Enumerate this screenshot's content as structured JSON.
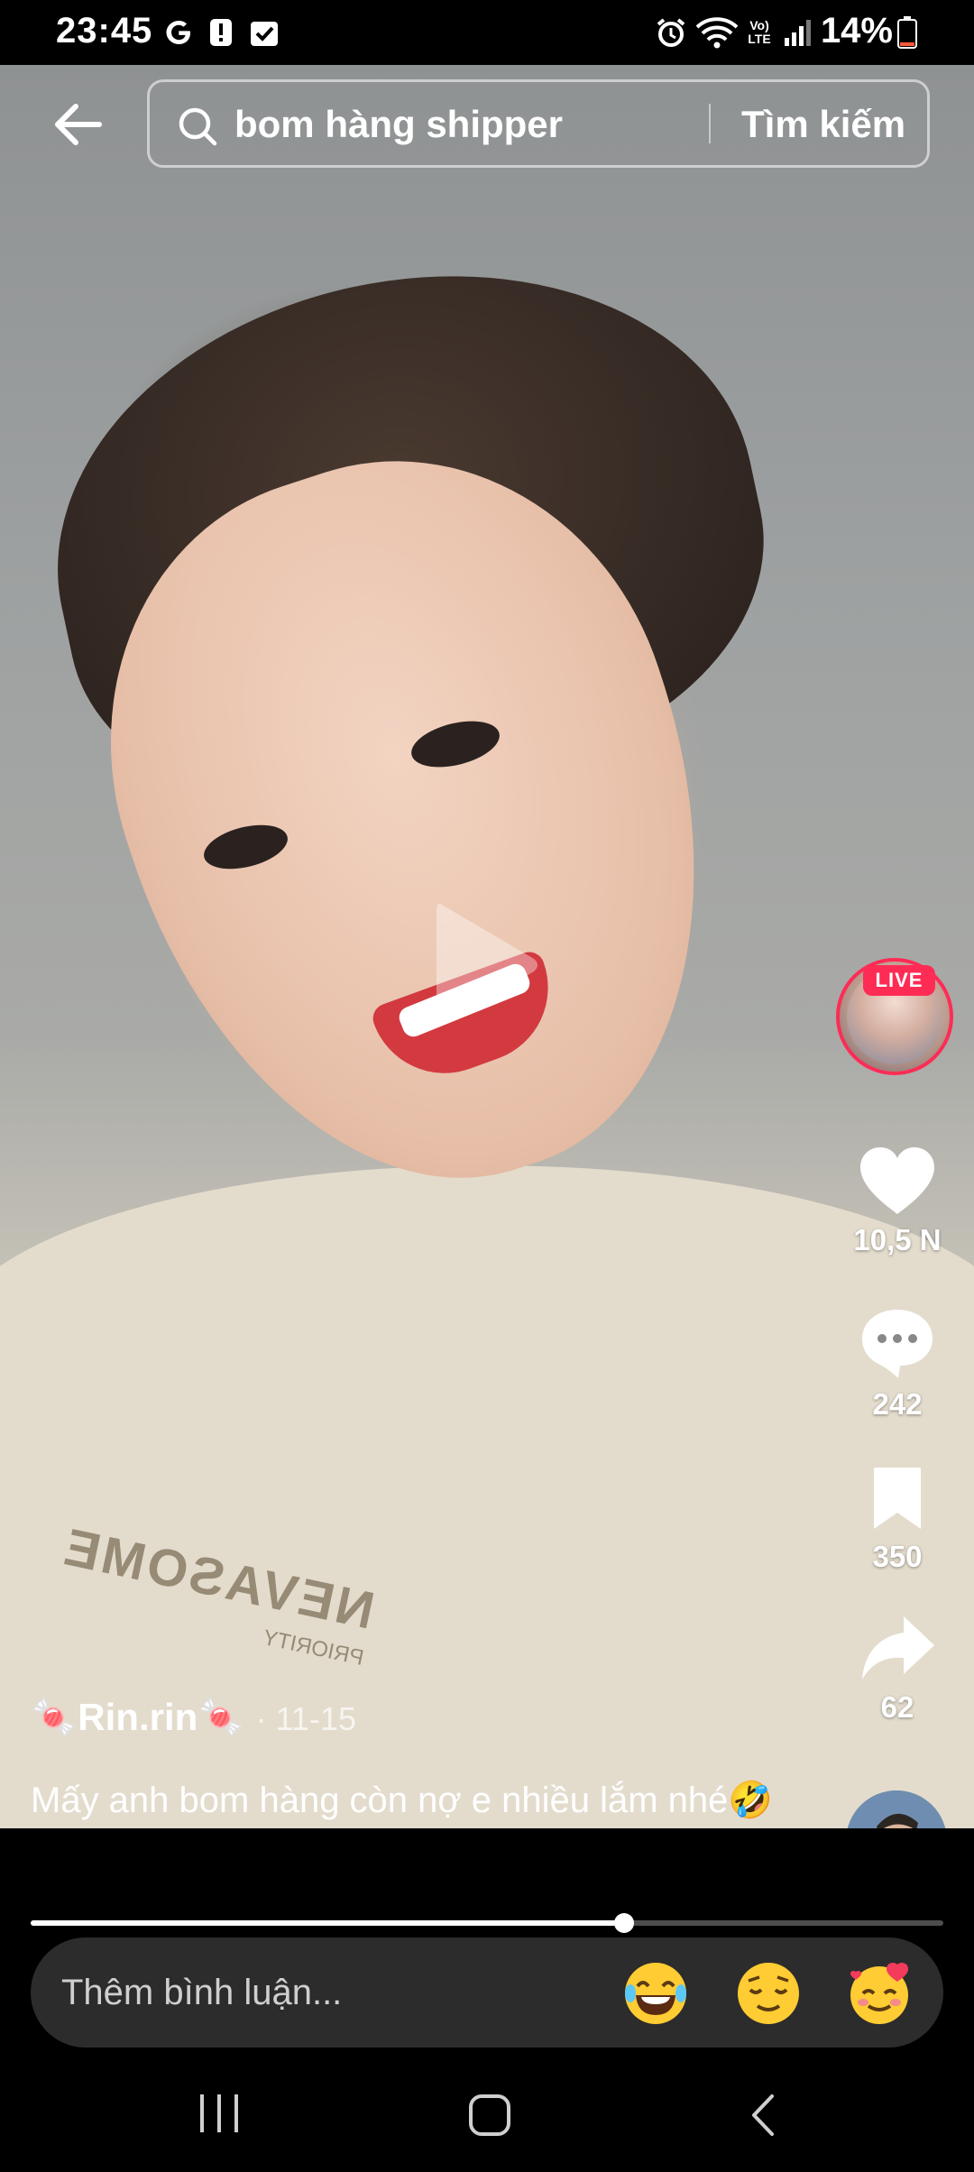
{
  "status_bar": {
    "time": "23:45",
    "battery": "14%",
    "icons": [
      "google-icon",
      "alert-icon",
      "checkbox-icon",
      "alarm-icon",
      "wifi-icon",
      "volte-icon",
      "signal-icon",
      "battery-icon"
    ],
    "volte_label": "Vo) LTE"
  },
  "search": {
    "query": "bom hàng shipper",
    "submit_label": "Tìm kiếm"
  },
  "video": {
    "shirt_brand": "NEVASOME",
    "shirt_sub": "PRIORITY"
  },
  "live": {
    "badge": "LIVE"
  },
  "actions": {
    "likes": "10,5 N",
    "comments": "242",
    "bookmarks": "350",
    "shares": "62"
  },
  "post": {
    "author": "🍬Rin.rin🍬",
    "date": "· 11-15",
    "caption": "Mấy anh bom hàng còn nợ e nhiều lắm nhé🤣",
    "progress": 0.65
  },
  "comment_bar": {
    "placeholder": "Thêm bình luận...",
    "emojis": [
      "😂",
      "😌",
      "🥰"
    ]
  },
  "colors": {
    "live_accent": "#fe2c55",
    "comment_bar_bg": "#2c2c2c"
  }
}
